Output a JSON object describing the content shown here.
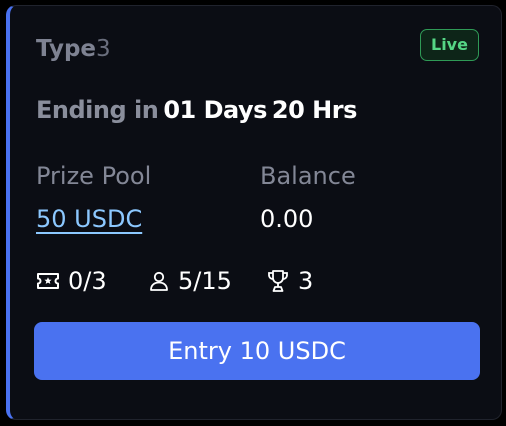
{
  "card": {
    "title_bold": "Type",
    "title_suffix": "3",
    "status_badge": "Live",
    "ending_label": "Ending in",
    "ending_days": "01 Days",
    "ending_hours": "20 Hrs",
    "prize_pool_label": "Prize Pool",
    "prize_pool_value": "50 USDC",
    "balance_label": "Balance",
    "balance_value": "0.00",
    "stats": {
      "tickets": "0/3",
      "players": "5/15",
      "winners": "3"
    },
    "entry_button_label": "Entry 10 USDC"
  },
  "colors": {
    "accent": "#4a72f0",
    "live_green": "#55d585",
    "link_blue": "#8cc8ff",
    "card_background": "#0b0d14"
  },
  "icons": {
    "tickets": "ticket-icon",
    "players": "user-icon",
    "winners": "trophy-icon"
  }
}
